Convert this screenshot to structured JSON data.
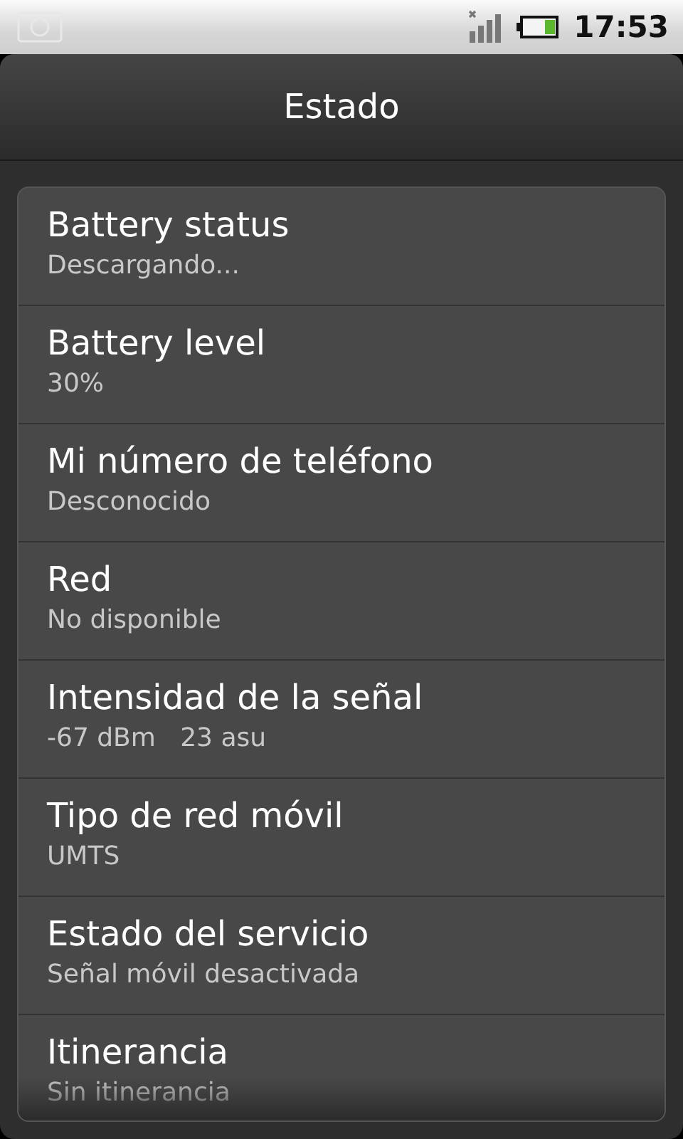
{
  "status_bar": {
    "time": "17:53"
  },
  "window": {
    "title": "Estado"
  },
  "items": [
    {
      "title": "Battery status",
      "value": "Descargando..."
    },
    {
      "title": "Battery level",
      "value": "30%"
    },
    {
      "title": "Mi número de teléfono",
      "value": "Desconocido"
    },
    {
      "title": "Red",
      "value": "No disponible"
    },
    {
      "title": "Intensidad de la señal",
      "value": "-67 dBm   23 asu"
    },
    {
      "title": "Tipo de red móvil",
      "value": "UMTS"
    },
    {
      "title": "Estado del servicio",
      "value": "Señal móvil desactivada"
    },
    {
      "title": "Itinerancia",
      "value": "Sin itinerancia"
    }
  ]
}
